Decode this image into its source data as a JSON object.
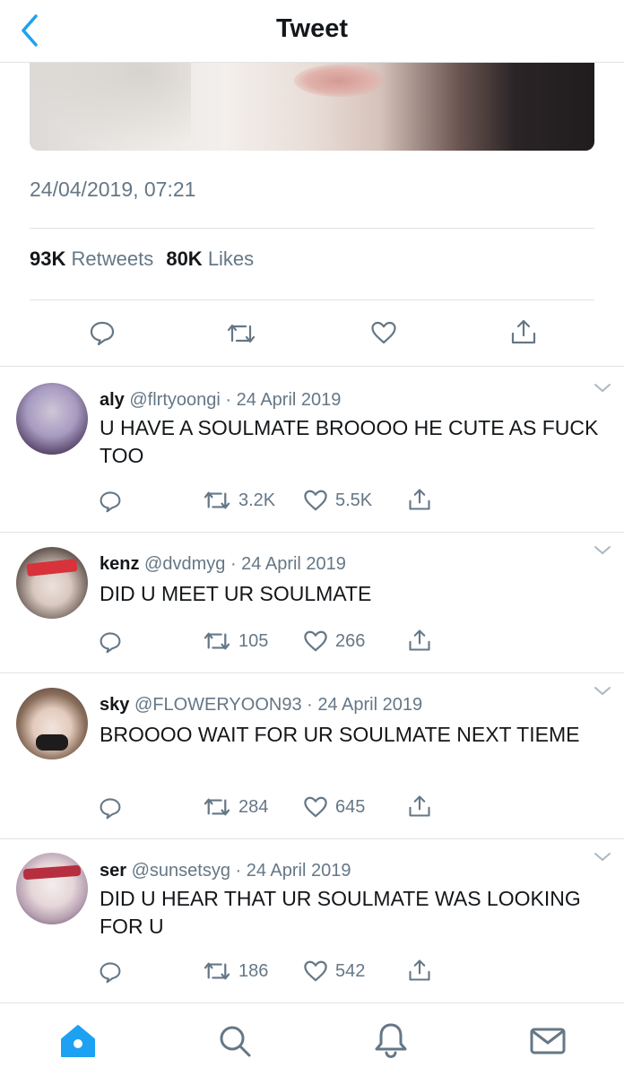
{
  "header": {
    "title": "Tweet",
    "back_icon": "chevron-left-icon"
  },
  "tweet": {
    "timestamp": "24/04/2019, 07:21",
    "retweet_count": "93K",
    "retweet_label": "Retweets",
    "like_count": "80K",
    "like_label": "Likes",
    "actions": [
      "reply-icon",
      "retweet-icon",
      "heart-icon",
      "share-icon"
    ]
  },
  "replies": [
    {
      "name": "aly",
      "handle": "@flrtyoongi",
      "date": "24 April 2019",
      "text": "U HAVE A SOULMATE BROOOO HE CUTE AS FUCK TOO",
      "retweets": "3.2K",
      "likes": "5.5K"
    },
    {
      "name": "kenz",
      "handle": "@dvdmyg",
      "date": "24 April 2019",
      "text": "DID U MEET UR SOULMATE",
      "retweets": "105",
      "likes": "266"
    },
    {
      "name": "sky",
      "handle": "@FLOWERYOON93",
      "date": "24 April 2019",
      "text": "BROOOO WAIT FOR UR SOULMATE NEXT TIEME",
      "retweets": "284",
      "likes": "645"
    },
    {
      "name": "ser",
      "handle": "@sunsetsyg",
      "date": "24 April 2019",
      "text": "DID U HEAR THAT UR SOULMATE WAS LOOKING FOR U",
      "retweets": "186",
      "likes": "542"
    }
  ],
  "tabbar": [
    "home-icon",
    "search-icon",
    "notifications-icon",
    "messages-icon"
  ],
  "colors": {
    "accent": "#1da1f2",
    "text": "#14171a",
    "secondary": "#657786",
    "divider": "#dfe3e6"
  }
}
